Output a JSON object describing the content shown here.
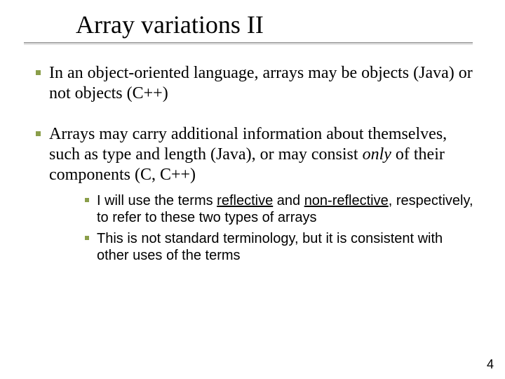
{
  "title": "Array variations II",
  "bullets": {
    "b1": "In an object-oriented language, arrays may be objects (Java) or not objects (C++)",
    "b2_pre": "Arrays may carry additional information about themselves, such as type and length (Java), or may consist ",
    "b2_only": "only",
    "b2_post": " of their components (C, C++)",
    "s1_pre": "I will use the terms ",
    "s1_refl": "reflective",
    "s1_mid": " and ",
    "s1_nonrefl": "non-reflective",
    "s1_post": ", respectively, to refer to these two types of arrays",
    "s2": "This is not standard terminology, but it is consistent with other uses of the terms"
  },
  "page_number": "4"
}
